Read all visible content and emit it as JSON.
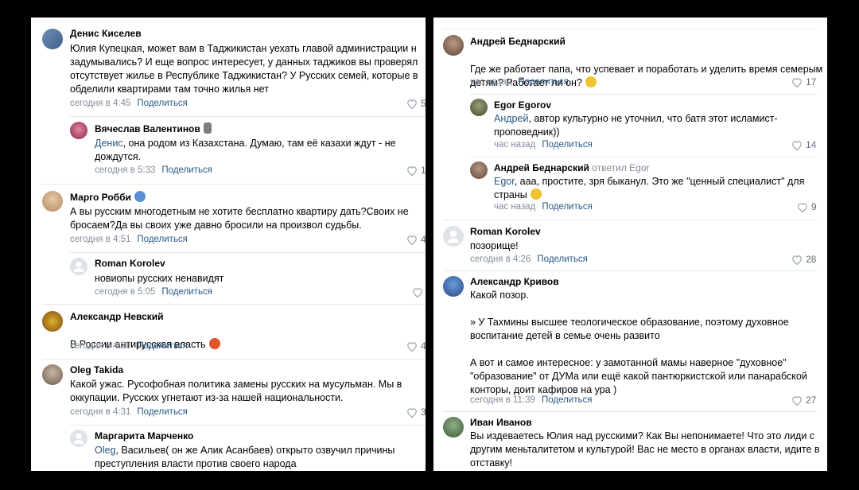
{
  "share_label": "Поделиться",
  "left": {
    "c1": {
      "author": "Денис Киселев",
      "text": "Юлия Купецкая, может вам в Таджикистан уехать главой администрации н\nзадумывались? И еще вопрос интересует, у данных таджиков вы проверял\nотсутствует жилье в Республике Таджикистан? У Русских семей, которые в\nобделили квартирами там точно жилья нет",
      "time": "сегодня в 4:45",
      "likes": "5"
    },
    "c2": {
      "author": "Вячеслав Валентинов",
      "mention": "Денис",
      "text": ", она родом из Казахстана. Думаю, там её казахи ждут - не\nдождутся.",
      "time": "сегодня в 5:33",
      "likes": "1"
    },
    "c3": {
      "author": "Марго Робби",
      "text": "А вы русским многодетным не хотите бесплатно квартиру дать?Своих не\nбросаем?Да вы своих уже давно бросили на произвол судьбы.",
      "time": "сегодня в 4:51",
      "likes": "4"
    },
    "c4": {
      "author": "Roman Korolev",
      "text": "новиопы русских ненавидят",
      "time": "сегодня в 5:05",
      "likes": ""
    },
    "c5": {
      "author": "Александр Невский",
      "text": "В России антирусская власть",
      "time": "сегодня в 4:20",
      "likes": "4"
    },
    "c6": {
      "author": "Oleg Takida",
      "text": "Какой ужас. Русофобная политика замены русских на мусульман. Мы в\nоккупации. Русских угнетают из-за нашей национальности.",
      "time": "сегодня в 4:31",
      "likes": "3"
    },
    "c7": {
      "author": "Маргарита Марченко",
      "mention": "Oleg",
      "text": ", Васильев( он же Алик Асанбаев) открыто озвучил причины\nпреступления власти против своего народа",
      "time": "",
      "likes": ""
    }
  },
  "right": {
    "c1": {
      "author": "Андрей Беднарский",
      "text": "Где же работает папа, что успевает и поработать и уделить время семерым\nдетям? Работает ли он?",
      "time": "час назад",
      "likes": "17"
    },
    "c2": {
      "author": "Egor Egorov",
      "mention": "Андрей",
      "text": ", автор культурно не уточнил, что батя этот исламист-\nпроповедник))",
      "time": "час назад",
      "likes": "14"
    },
    "c3": {
      "author": "Андрей Беднарский",
      "replied": "ответил Egor",
      "mention": "Egor",
      "text": ", ааа, простите, зря быканул. Это же \"ценный специалист\" для\nстраны",
      "time": "час назад",
      "likes": "9"
    },
    "c4": {
      "author": "Roman Korolev",
      "text": "позорище!",
      "time": "сегодня в 4:26",
      "likes": "28"
    },
    "c5": {
      "author": "Александр Кривов",
      "text": "Какой позор.\n\n» У Тахмины высшее теологическое образование, поэтому духовное\nвоспитание детей в семье очень развито\n\nА вот и самое интересное: у замотанной мамы наверное \"духовное\"\n\"образование\" от ДУМа или ещё какой пантюркистской или панарабской\nконторы, доит кафиров на ура )",
      "time": "сегодня в 11:39",
      "likes": "27"
    },
    "c6": {
      "author": "Иван Иванов",
      "text": "Вы издеваетесь Юлия над русскими? Как Вы непонимаете! Что это лиди с\nдругим меньталитетом и культурой! Вас не место в органах власти, идите в\nотставку!",
      "time": "",
      "likes": ""
    }
  }
}
